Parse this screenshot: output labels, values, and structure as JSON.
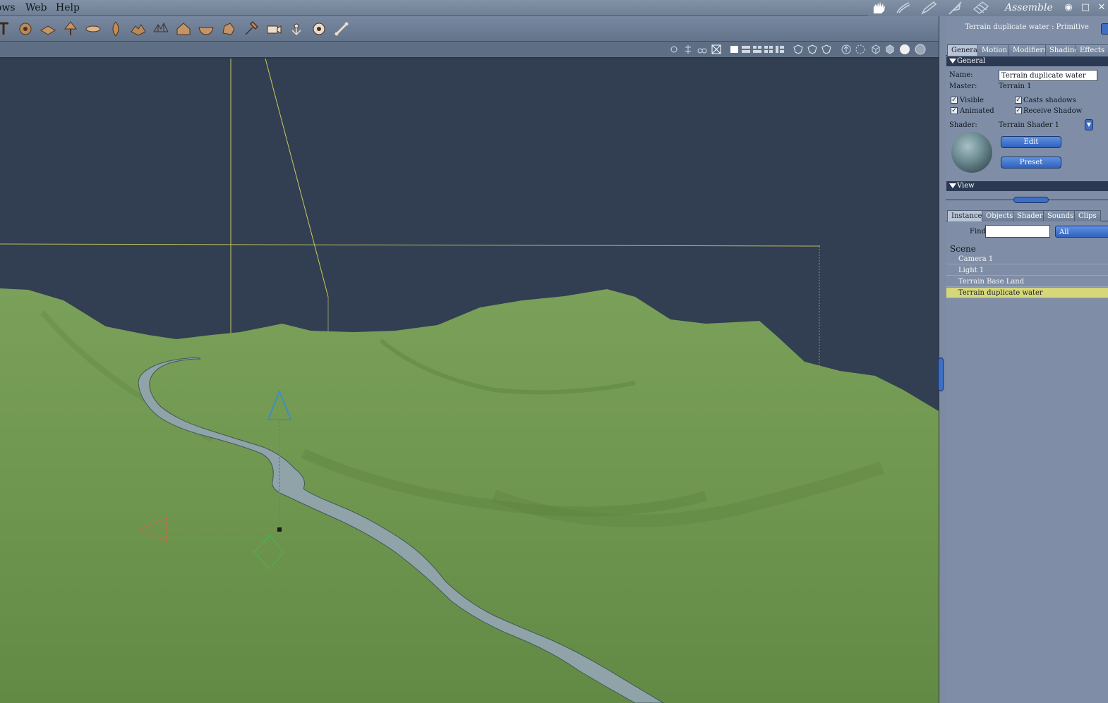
{
  "menubar": {
    "windows": "ows",
    "web": "Web",
    "help": "Help"
  },
  "rooms": {
    "active": "Assemble",
    "icons": [
      "hand-icon",
      "paint-brush-icon",
      "pencil-icon",
      "feather-icon",
      "film-icon"
    ]
  },
  "toolbar": {
    "tools": [
      "text-tool-icon",
      "gear-cluster-icon",
      "plane-icon",
      "tree-icon",
      "cloud-icon",
      "flame-icon",
      "terrain-icon",
      "terrain-wire-icon",
      "house-icon",
      "bowl-icon",
      "rock-icon",
      "hammer-icon",
      "camera-icon",
      "light-icon",
      "target-icon",
      "bone-icon"
    ]
  },
  "panel": {
    "header": "Terrain duplicate water : Primitive",
    "tabs": [
      "General",
      "Motion",
      "Modifiers",
      "Shading",
      "Effects"
    ],
    "section_general": "General",
    "name_label": "Name:",
    "name_value": "Terrain duplicate water",
    "master_label": "Master:",
    "master_value": "Terrain 1",
    "visible_label": "Visible",
    "casts_shadows_label": "Casts shadows",
    "animated_label": "Animated",
    "receive_shadow_label": "Receive Shadow",
    "checks": {
      "visible": true,
      "casts_shadows": true,
      "animated": true,
      "receive_shadow": true
    },
    "shader_label": "Shader:",
    "shader_value": "Terrain Shader 1",
    "edit_button": "Edit",
    "preset_button": "Preset",
    "section_view": "View"
  },
  "browser": {
    "tabs": [
      "Instances",
      "Objects",
      "Shaders",
      "Sounds",
      "Clips"
    ],
    "find_label": "Find:",
    "find_value": "",
    "filter_value": "All",
    "scene_title": "Scene",
    "items": [
      {
        "label": "Camera 1",
        "selected": false
      },
      {
        "label": "Light 1",
        "selected": false
      },
      {
        "label": "Terrain Base Land",
        "selected": false
      },
      {
        "label": "Terrain duplicate water",
        "selected": true
      }
    ]
  },
  "colors": {
    "viewport_bg": "#323e51",
    "terrain": "#6f954e",
    "water": "#8ea2a8",
    "selection": "#d6d67a",
    "accent_blue": "#3d6fc4"
  }
}
